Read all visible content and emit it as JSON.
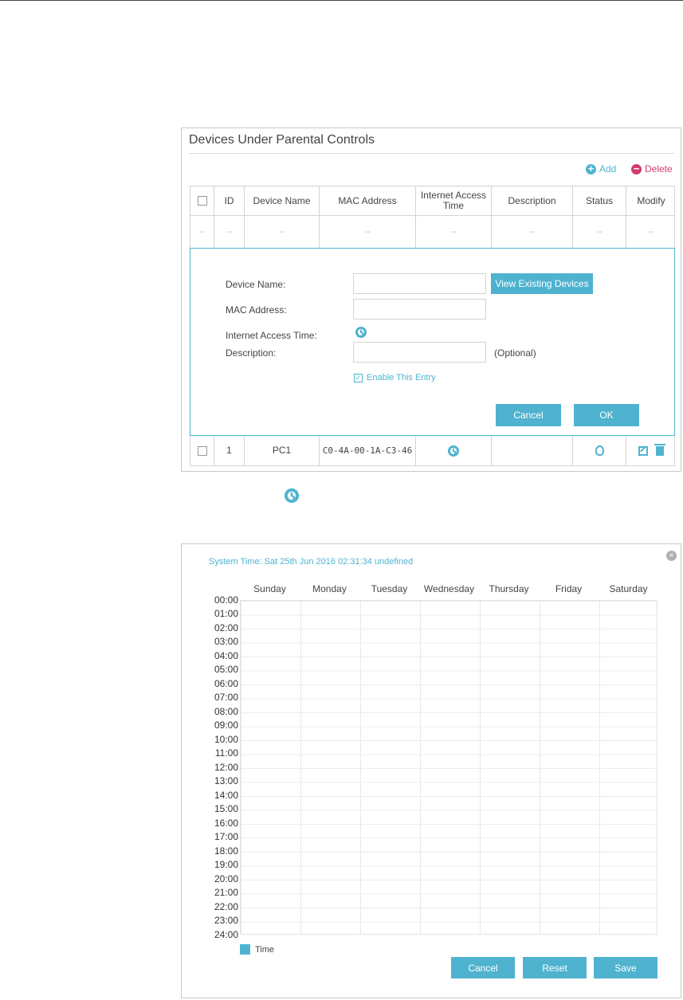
{
  "panel1": {
    "title": "Devices Under Parental Controls",
    "add_label": "Add",
    "delete_label": "Delete",
    "columns": [
      "ID",
      "Device Name",
      "MAC Address",
      "Internet Access Time",
      "Description",
      "Status",
      "Modify"
    ],
    "dash": "--",
    "form": {
      "device_name_label": "Device Name:",
      "mac_label": "MAC Address:",
      "access_time_label": "Internet Access Time:",
      "description_label": "Description:",
      "view_devices_label": "View Existing Devices",
      "optional_label": "(Optional)",
      "enable_label": "Enable This Entry",
      "cancel_label": "Cancel",
      "ok_label": "OK"
    },
    "row": {
      "id": "1",
      "device_name": "PC1",
      "mac": "C0-4A-00-1A-C3-46"
    }
  },
  "panel2": {
    "system_time": "System Time: Sat 25th Jun 2016 02:31:34 undefined",
    "days": [
      "Sunday",
      "Monday",
      "Tuesday",
      "Wednesday",
      "Thursday",
      "Friday",
      "Saturday"
    ],
    "hours": [
      "00:00",
      "01:00",
      "02:00",
      "03:00",
      "04:00",
      "05:00",
      "06:00",
      "07:00",
      "08:00",
      "09:00",
      "10:00",
      "11:00",
      "12:00",
      "13:00",
      "14:00",
      "15:00",
      "16:00",
      "17:00",
      "18:00",
      "19:00",
      "20:00",
      "21:00",
      "22:00",
      "23:00",
      "24:00"
    ],
    "legend": "Time",
    "cancel_label": "Cancel",
    "reset_label": "Reset",
    "save_label": "Save"
  },
  "colors": {
    "accent": "#4fb3cf",
    "delete": "#d23c6f"
  }
}
